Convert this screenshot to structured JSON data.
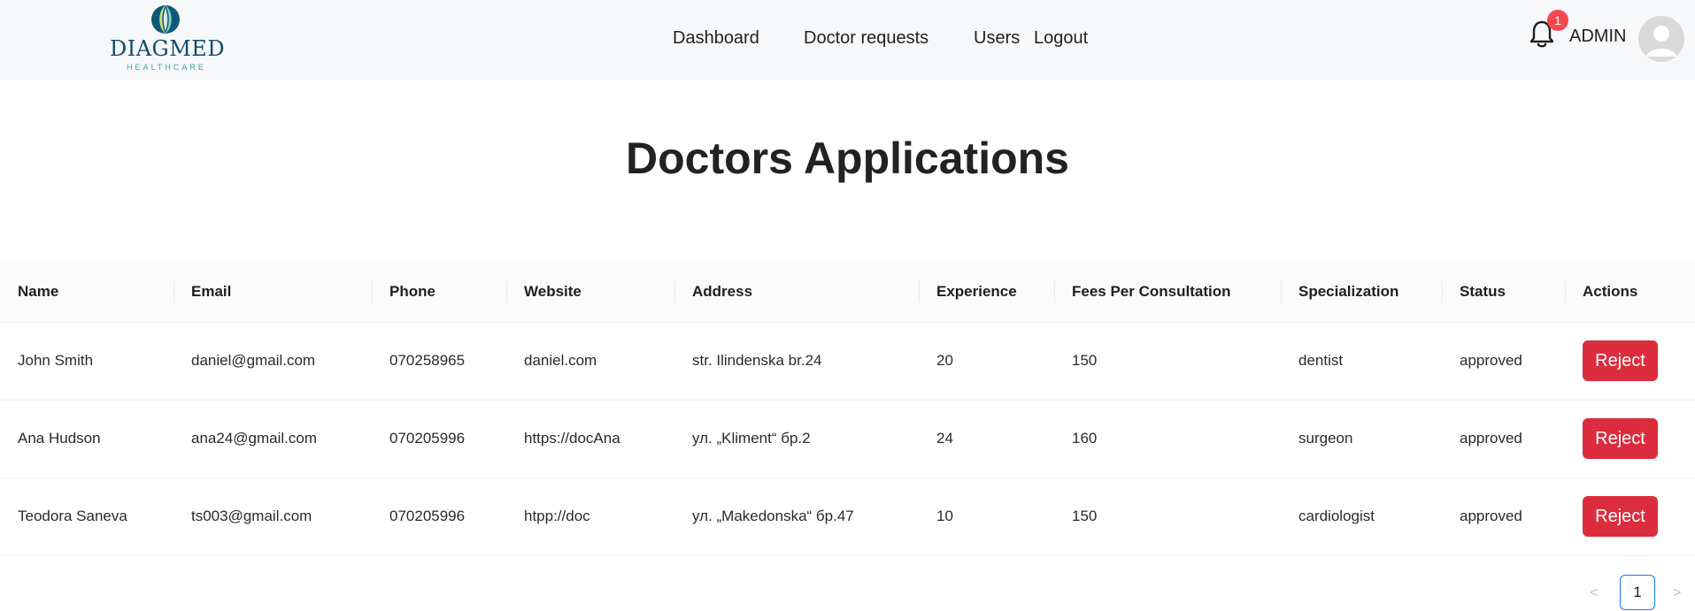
{
  "brand": {
    "name": "DIAGMED",
    "tagline": "HEALTHCARE"
  },
  "nav": {
    "links": [
      "Dashboard",
      "Doctor requests",
      "Users",
      "Logout"
    ]
  },
  "header": {
    "notification_count": "1",
    "user_label": "ADMIN"
  },
  "main": {
    "title": "Doctors Applications"
  },
  "table": {
    "columns": [
      "Name",
      "Email",
      "Phone",
      "Website",
      "Address",
      "Experience",
      "Fees Per Consultation",
      "Specialization",
      "Status",
      "Actions"
    ],
    "rows": [
      {
        "name": "John Smith",
        "email": "daniel@gmail.com",
        "phone": "070258965",
        "website": "daniel.com",
        "address": "str. Ilindenska br.24",
        "experience": "20",
        "fees": "150",
        "specialization": "dentist",
        "status": "approved",
        "action": "Reject"
      },
      {
        "name": "Ana Hudson",
        "email": "ana24@gmail.com",
        "phone": "070205996",
        "website": "https://docAna",
        "address": "ул. „Kliment“ бр.2",
        "experience": "24",
        "fees": "160",
        "specialization": "surgeon",
        "status": "approved",
        "action": "Reject"
      },
      {
        "name": "Teodora Saneva",
        "email": "ts003@gmail.com",
        "phone": "070205996",
        "website": "htpp://doc",
        "address": "ул. „Makedonska“ бр.47",
        "experience": "10",
        "fees": "150",
        "specialization": "cardiologist",
        "status": "approved",
        "action": "Reject"
      }
    ]
  },
  "pagination": {
    "prev": "<",
    "current": "1",
    "next": ">"
  },
  "colors": {
    "navbar_bg": "#f7f8fa",
    "danger": "#dc2d3e",
    "badge": "#f5484f",
    "brand": "#0c4a6e",
    "pagination_active": "#1677ff"
  }
}
